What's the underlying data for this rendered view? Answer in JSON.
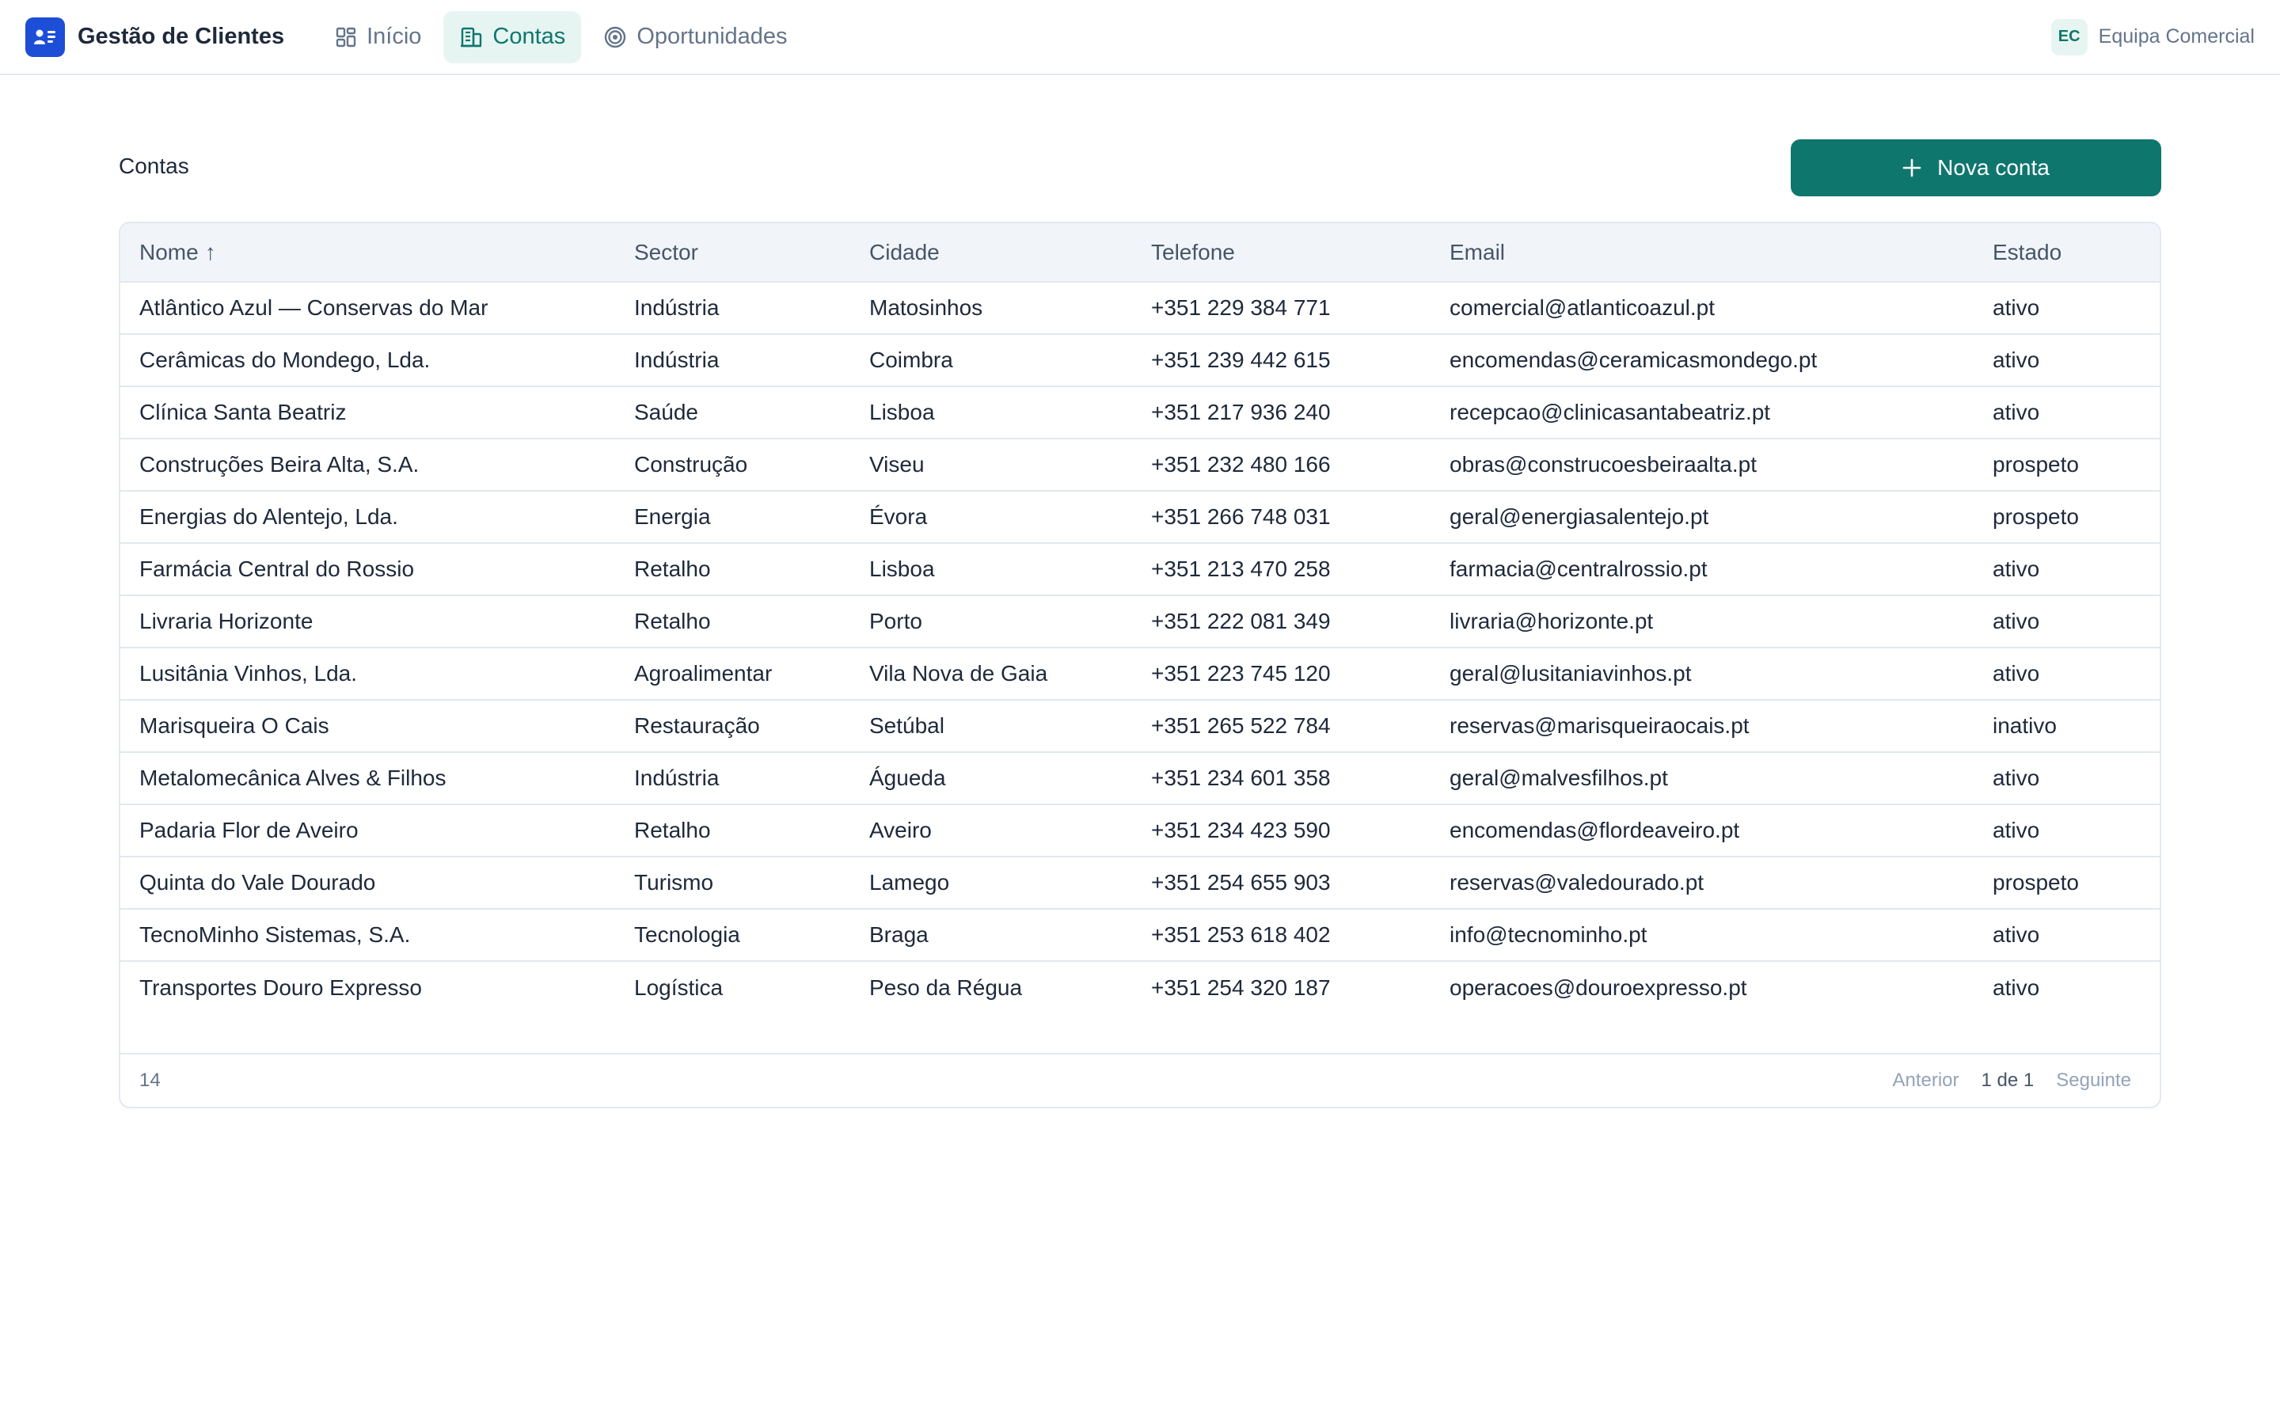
{
  "app": {
    "name": "Gestão de Clientes",
    "logo_icon": "contact-card-icon",
    "accent": "#0f766e",
    "brand_color": "#1d4ed8"
  },
  "nav": {
    "items": [
      {
        "label": "Início",
        "icon": "dashboard-icon",
        "active": false
      },
      {
        "label": "Contas",
        "icon": "building-icon",
        "active": true
      },
      {
        "label": "Oportunidades",
        "icon": "target-icon",
        "active": false
      }
    ]
  },
  "team": {
    "initials": "EC",
    "name": "Equipa Comercial"
  },
  "page": {
    "title": "Contas",
    "new_button_label": "Nova conta"
  },
  "table": {
    "columns": [
      "Nome",
      "Sector",
      "Cidade",
      "Telefone",
      "Email",
      "Estado"
    ],
    "sort_indicator": "↑",
    "rows": [
      [
        "Atlântico Azul — Conservas do Mar",
        "Indústria",
        "Matosinhos",
        "+351 229 384 771",
        "comercial@atlanticoazul.pt",
        "ativo"
      ],
      [
        "Cerâmicas do Mondego, Lda.",
        "Indústria",
        "Coimbra",
        "+351 239 442 615",
        "encomendas@ceramicasmondego.pt",
        "ativo"
      ],
      [
        "Clínica Santa Beatriz",
        "Saúde",
        "Lisboa",
        "+351 217 936 240",
        "recepcao@clinicasantabeatriz.pt",
        "ativo"
      ],
      [
        "Construções Beira Alta, S.A.",
        "Construção",
        "Viseu",
        "+351 232 480 166",
        "obras@construcoesbeiraalta.pt",
        "prospeto"
      ],
      [
        "Energias do Alentejo, Lda.",
        "Energia",
        "Évora",
        "+351 266 748 031",
        "geral@energiasalentejo.pt",
        "prospeto"
      ],
      [
        "Farmácia Central do Rossio",
        "Retalho",
        "Lisboa",
        "+351 213 470 258",
        "farmacia@centralrossio.pt",
        "ativo"
      ],
      [
        "Livraria Horizonte",
        "Retalho",
        "Porto",
        "+351 222 081 349",
        "livraria@horizonte.pt",
        "ativo"
      ],
      [
        "Lusitânia Vinhos, Lda.",
        "Agroalimentar",
        "Vila Nova de Gaia",
        "+351 223 745 120",
        "geral@lusitaniavinhos.pt",
        "ativo"
      ],
      [
        "Marisqueira O Cais",
        "Restauração",
        "Setúbal",
        "+351 265 522 784",
        "reservas@marisqueiraocais.pt",
        "inativo"
      ],
      [
        "Metalomecânica Alves & Filhos",
        "Indústria",
        "Águeda",
        "+351 234 601 358",
        "geral@malvesfilhos.pt",
        "ativo"
      ],
      [
        "Padaria Flor de Aveiro",
        "Retalho",
        "Aveiro",
        "+351 234 423 590",
        "encomendas@flordeaveiro.pt",
        "ativo"
      ],
      [
        "Quinta do Vale Dourado",
        "Turismo",
        "Lamego",
        "+351 254 655 903",
        "reservas@valedourado.pt",
        "prospeto"
      ],
      [
        "TecnoMinho Sistemas, S.A.",
        "Tecnologia",
        "Braga",
        "+351 253 618 402",
        "info@tecnominho.pt",
        "ativo"
      ],
      [
        "Transportes Douro Expresso",
        "Logística",
        "Peso da Régua",
        "+351 254 320 187",
        "operacoes@douroexpresso.pt",
        "ativo"
      ]
    ]
  },
  "footer": {
    "count": "14",
    "prev_label": "Anterior",
    "page_label": "1 de 1",
    "next_label": "Seguinte"
  }
}
